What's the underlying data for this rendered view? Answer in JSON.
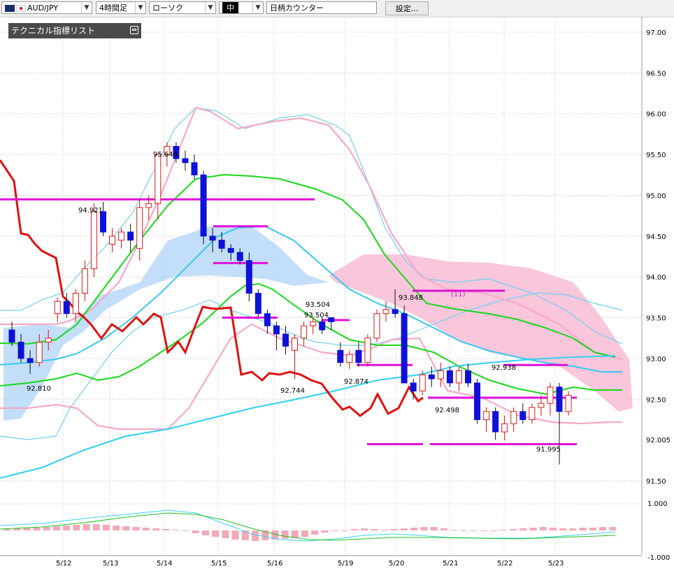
{
  "toolbar": {
    "pair": "AUD/JPY",
    "timeframe": "4時間足",
    "chart_style": "ローソク",
    "size": "中",
    "brand_search": "日柄カウンター",
    "settings": "設定..."
  },
  "indicator_panel": {
    "title": "テクニカル指標リスト"
  },
  "colors": {
    "up_candle": "#e01818",
    "down_candle": "#1010d8",
    "bollinger_outer": "#70d0f0",
    "bollinger_inner": "#f8a8c8",
    "ma_short": "#18d818",
    "ma_mid": "#38c8f0",
    "chikou": "#e01010",
    "kumo_bull": "#b8d8f8",
    "kumo_bear": "#f8c0d8",
    "level_line": "#e010d8",
    "macd_hist": "#f4a8b8"
  },
  "chart_data": {
    "type": "candlestick",
    "price_axis": {
      "ticks": [
        "97.00",
        "96.50",
        "96.00",
        "95.50",
        "95.00",
        "94.50",
        "94.00",
        "93.50",
        "93.00",
        "92.50",
        "92.005",
        "91.50"
      ],
      "ylim": [
        91.2,
        97.2
      ]
    },
    "date_labels": [
      "5/12",
      "5/13",
      "5/14",
      "5/15",
      "5/16",
      "5/19",
      "5/20",
      "5/21",
      "5/22",
      "5/23"
    ],
    "sub_axis": {
      "ticks": [
        "1.000",
        "-1.000"
      ]
    },
    "annotations": [
      "94.921",
      "95.648",
      "93.504",
      "93.504",
      "93.848",
      "92.810",
      "92.744",
      "92.874",
      "92.498",
      "92.938",
      "91.995",
      "(11)"
    ],
    "candles": [
      [
        93.35,
        93.45,
        93.15,
        93.2
      ],
      [
        93.2,
        93.3,
        92.95,
        93.0
      ],
      [
        93.0,
        93.1,
        92.81,
        92.95
      ],
      [
        92.95,
        93.3,
        92.9,
        93.2
      ],
      [
        93.2,
        93.35,
        93.1,
        93.25
      ],
      [
        93.55,
        93.75,
        93.45,
        93.7
      ],
      [
        93.7,
        93.8,
        93.5,
        93.55
      ],
      [
        93.55,
        93.85,
        93.45,
        93.8
      ],
      [
        93.8,
        94.2,
        93.7,
        94.1
      ],
      [
        94.1,
        94.9,
        94.0,
        94.8
      ],
      [
        94.8,
        94.92,
        94.5,
        94.55
      ],
      [
        94.4,
        94.6,
        94.3,
        94.5
      ],
      [
        94.45,
        94.6,
        94.35,
        94.55
      ],
      [
        94.55,
        94.65,
        94.3,
        94.45
      ],
      [
        94.35,
        94.95,
        94.2,
        94.85
      ],
      [
        94.85,
        95.0,
        94.7,
        94.9
      ],
      [
        94.9,
        95.5,
        94.7,
        95.5
      ],
      [
        95.5,
        95.648,
        95.35,
        95.6
      ],
      [
        95.6,
        95.65,
        95.4,
        95.45
      ],
      [
        95.45,
        95.55,
        95.3,
        95.4
      ],
      [
        95.4,
        95.5,
        95.2,
        95.25
      ],
      [
        95.25,
        95.3,
        94.4,
        94.5
      ],
      [
        94.5,
        94.6,
        94.3,
        94.45
      ],
      [
        94.45,
        94.55,
        94.3,
        94.35
      ],
      [
        94.35,
        94.4,
        94.2,
        94.3
      ],
      [
        94.3,
        94.35,
        94.15,
        94.2
      ],
      [
        94.2,
        94.3,
        93.7,
        93.8
      ],
      [
        93.8,
        93.85,
        93.5,
        93.55
      ],
      [
        93.55,
        93.6,
        93.3,
        93.4
      ],
      [
        93.4,
        93.45,
        93.1,
        93.3
      ],
      [
        93.3,
        93.4,
        93.05,
        93.15
      ],
      [
        93.1,
        93.3,
        92.744,
        93.25
      ],
      [
        93.25,
        93.45,
        93.15,
        93.4
      ],
      [
        93.4,
        93.504,
        93.3,
        93.45
      ],
      [
        93.45,
        93.5,
        93.3,
        93.35
      ],
      [
        93.5,
        93.504,
        93.35,
        93.45
      ],
      [
        93.1,
        93.2,
        92.9,
        92.95
      ],
      [
        92.95,
        93.1,
        92.874,
        93.05
      ],
      [
        93.1,
        93.2,
        92.9,
        92.95
      ],
      [
        92.95,
        93.3,
        92.9,
        93.25
      ],
      [
        93.25,
        93.6,
        93.2,
        93.55
      ],
      [
        93.55,
        93.7,
        93.45,
        93.6
      ],
      [
        93.6,
        93.848,
        93.5,
        93.55
      ],
      [
        93.55,
        93.65,
        92.8,
        92.7
      ],
      [
        92.7,
        92.75,
        92.498,
        92.6
      ],
      [
        92.6,
        92.85,
        92.55,
        92.8
      ],
      [
        92.8,
        92.9,
        92.65,
        92.75
      ],
      [
        92.75,
        92.95,
        92.65,
        92.85
      ],
      [
        92.85,
        92.9,
        92.65,
        92.7
      ],
      [
        92.7,
        92.9,
        92.6,
        92.85
      ],
      [
        92.85,
        92.938,
        92.65,
        92.7
      ],
      [
        92.7,
        92.75,
        92.2,
        92.25
      ],
      [
        92.25,
        92.4,
        92.1,
        92.35
      ],
      [
        92.35,
        92.4,
        92.0,
        92.1
      ],
      [
        92.1,
        92.3,
        91.995,
        92.2
      ],
      [
        92.2,
        92.4,
        92.1,
        92.35
      ],
      [
        92.35,
        92.45,
        92.2,
        92.25
      ],
      [
        92.25,
        92.45,
        92.2,
        92.4
      ],
      [
        92.4,
        92.55,
        92.3,
        92.45
      ],
      [
        92.45,
        92.7,
        92.3,
        92.65
      ],
      [
        92.65,
        92.7,
        91.7,
        92.35
      ],
      [
        92.35,
        92.6,
        92.3,
        92.55
      ]
    ],
    "level_lines": [
      {
        "price": 94.95
      },
      {
        "price": 94.62
      },
      {
        "price": 94.17
      },
      {
        "price": 93.5
      },
      {
        "price": 93.47
      },
      {
        "price": 92.92
      },
      {
        "price": 93.83
      },
      {
        "price": 92.52
      },
      {
        "price": 92.92
      },
      {
        "price": 91.95
      },
      {
        "price": 91.95
      }
    ]
  }
}
